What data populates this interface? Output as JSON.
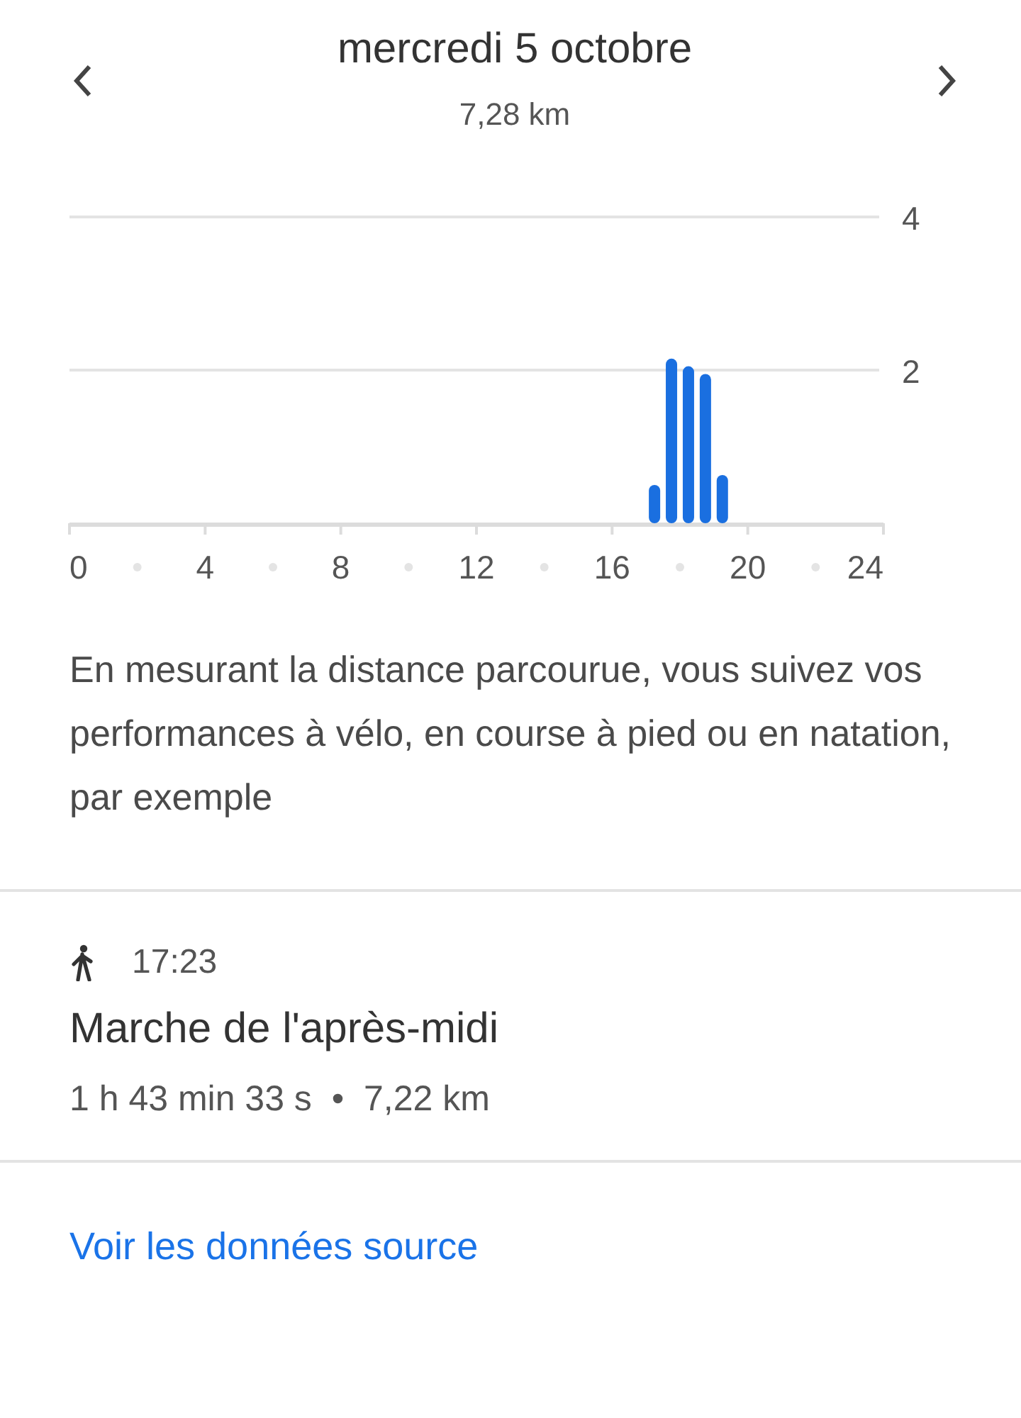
{
  "header": {
    "title": "mercredi 5 octobre",
    "subtitle": "7,28 km"
  },
  "chart": {
    "chart_data": {
      "type": "bar",
      "x": [
        17.25,
        17.75,
        18.25,
        18.75,
        19.25
      ],
      "values": [
        0.5,
        2.15,
        2.05,
        1.95,
        0.63
      ],
      "xlim": [
        0,
        24
      ],
      "ylim": [
        0,
        4
      ],
      "xticks": [
        0,
        4,
        8,
        12,
        16,
        20,
        24
      ],
      "yticks": [
        2,
        4
      ]
    }
  },
  "description": "En mesurant la distance parcourue, vous suivez vos performances à vélo, en course à pied ou en natation, par exemple",
  "activity": {
    "time": "17:23",
    "title": "Marche de l'après-midi",
    "details": "1 h 43 min 33 s  •  7,22 km"
  },
  "link": "Voir les données source"
}
